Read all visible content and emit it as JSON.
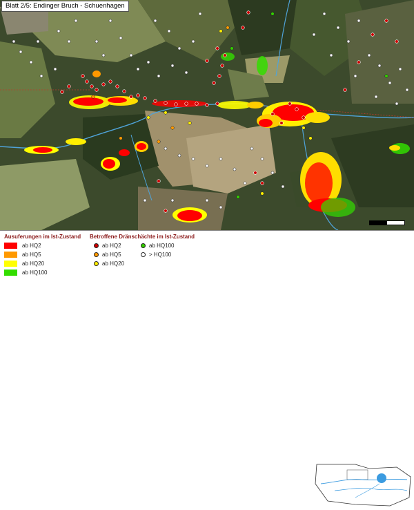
{
  "title": "Blatt 2/5: Endinger Bruch - Schuenhagen",
  "flood_legend": {
    "heading": "Ausuferungen im Ist-Zustand",
    "items": [
      {
        "label": "ab HQ2",
        "color": "#ff0000"
      },
      {
        "label": "ab HQ5",
        "color": "#ff9900"
      },
      {
        "label": "ab HQ20",
        "color": "#ffff00"
      },
      {
        "label": "ab HQ100",
        "color": "#33dd00"
      }
    ]
  },
  "shaft_legend": {
    "heading": "Betroffene Dränschächte im Ist-Zustand",
    "items": [
      {
        "label": "ab HQ2",
        "color": "#cc0000"
      },
      {
        "label": "ab HQ5",
        "color": "#ff9900"
      },
      {
        "label": "ab HQ20",
        "color": "#ffee00"
      },
      {
        "label": "ab HQ100",
        "color": "#33cc00"
      },
      {
        "label": "> HQ100",
        "color": "#ffffff"
      }
    ]
  },
  "colors": {
    "forest": "#2f3f22",
    "field_light": "#a99a76",
    "field_green": "#6f7d48",
    "river": "#4fa3d9",
    "overview_lake": "#3b9be0"
  }
}
